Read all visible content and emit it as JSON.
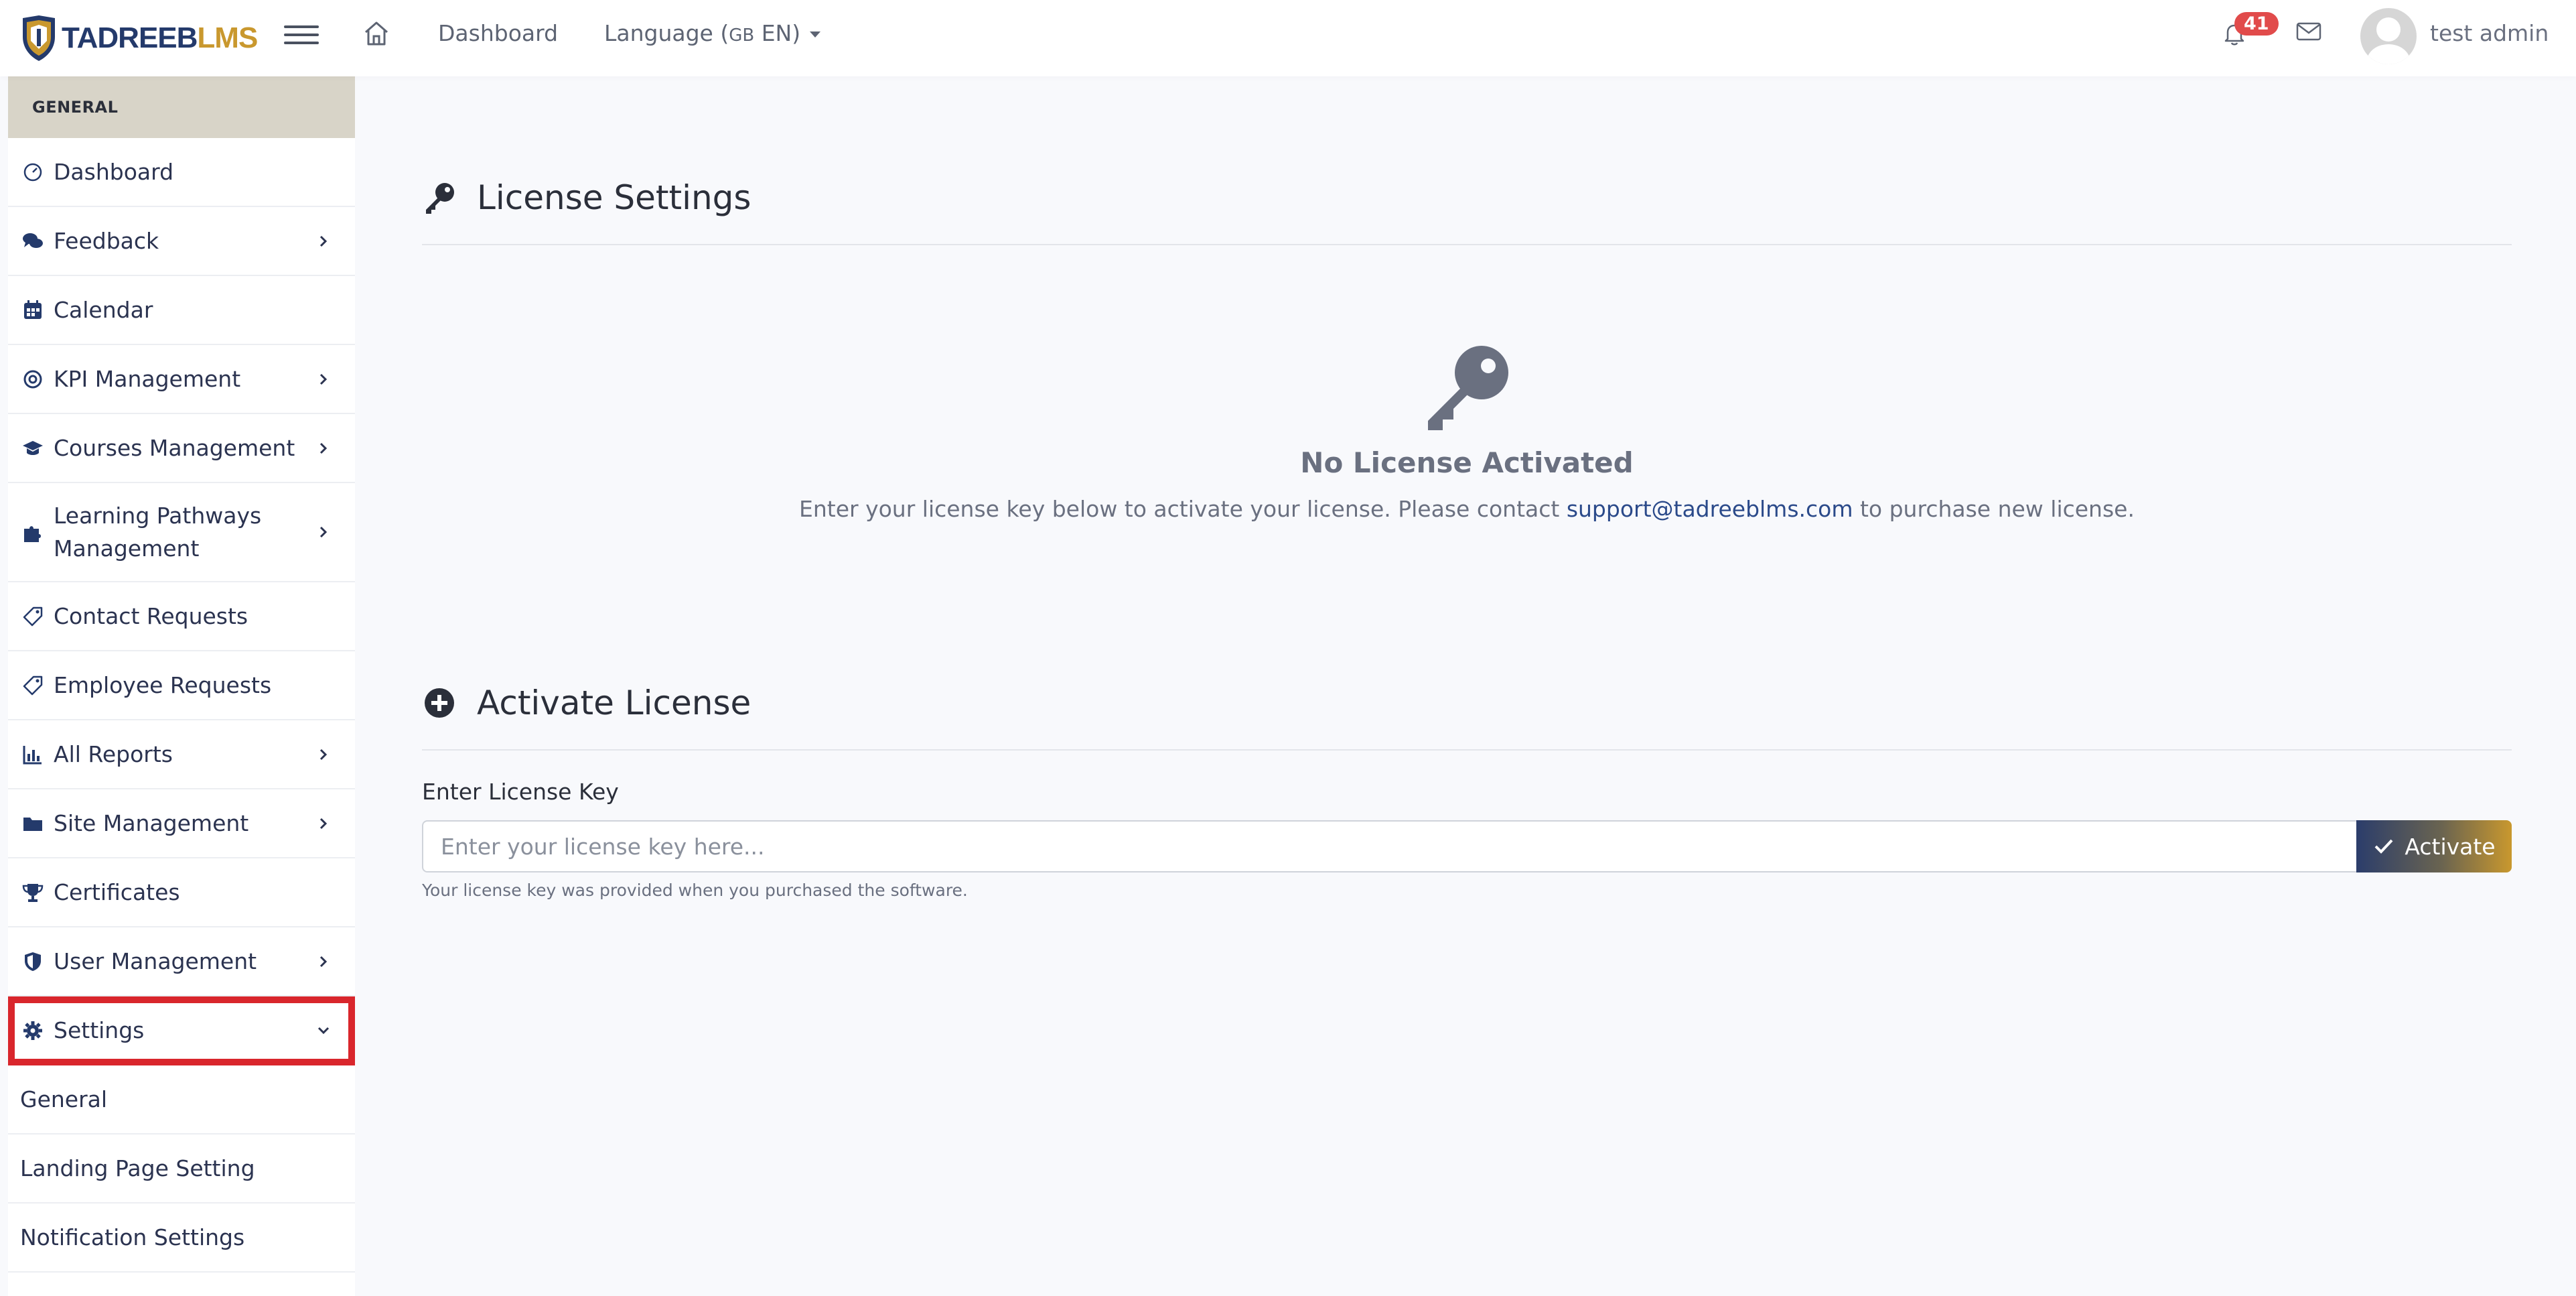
{
  "app": {
    "logo_part1": "TADREEB",
    "logo_part2": "LMS"
  },
  "topbar": {
    "dashboard_label": "Dashboard",
    "language_label": "Language (",
    "language_flag": "GB",
    "language_code": " EN)",
    "notification_count": "41",
    "user_name": "test admin"
  },
  "sidebar": {
    "header": "GENERAL",
    "items": [
      {
        "label": "Dashboard",
        "icon": "speedometer-icon",
        "has_children": false
      },
      {
        "label": "Feedback",
        "icon": "comments-icon",
        "has_children": true
      },
      {
        "label": "Calendar",
        "icon": "calendar-icon",
        "has_children": false
      },
      {
        "label": "KPI Management",
        "icon": "target-icon",
        "has_children": true
      },
      {
        "label": "Courses Management",
        "icon": "graduation-cap-icon",
        "has_children": true
      },
      {
        "label": "Learning Pathways Management",
        "icon": "puzzle-icon",
        "has_children": true
      },
      {
        "label": "Contact Requests",
        "icon": "tag-icon",
        "has_children": false
      },
      {
        "label": "Employee Requests",
        "icon": "tag-icon",
        "has_children": false
      },
      {
        "label": "All Reports",
        "icon": "bar-chart-icon",
        "has_children": true
      },
      {
        "label": "Site Management",
        "icon": "folder-icon",
        "has_children": true
      },
      {
        "label": "Certificates",
        "icon": "trophy-icon",
        "has_children": false
      },
      {
        "label": "User Management",
        "icon": "shield-icon",
        "has_children": true
      },
      {
        "label": "Settings",
        "icon": "gear-icon",
        "has_children": true,
        "expanded": true
      }
    ],
    "settings_subitems": [
      "General",
      "Landing Page Setting",
      "Notification Settings"
    ]
  },
  "main": {
    "license_settings_title": "License Settings",
    "empty_title": "No License Activated",
    "empty_desc_before": "Enter your license key below to activate your license. Please contact ",
    "empty_desc_email": "support@tadreeblms.com",
    "empty_desc_after": " to purchase new license.",
    "activate_title": "Activate License",
    "key_label": "Enter License Key",
    "key_placeholder": "Enter your license key here...",
    "key_value": "",
    "activate_button": "Activate",
    "help_text": "Your license key was provided when you purchased the software."
  },
  "colors": {
    "brand_navy": "#243a6b",
    "brand_gold": "#c9982e",
    "highlight_red": "#d9262c",
    "badge_red": "#e14b4b"
  }
}
